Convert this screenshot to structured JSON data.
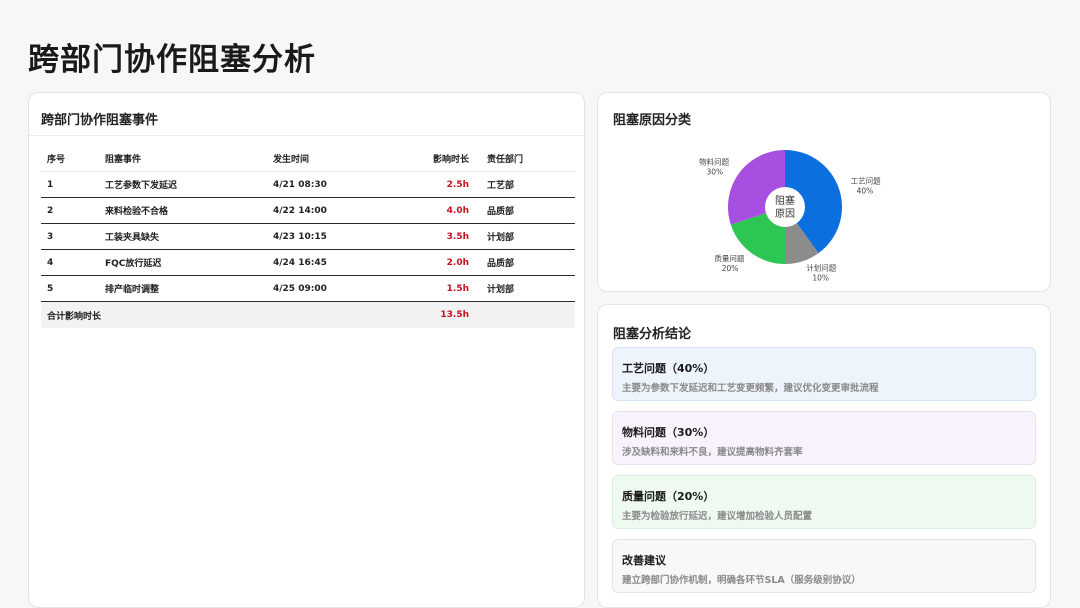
{
  "page": {
    "title": "跨部门协作阻塞分析"
  },
  "events_card": {
    "title": "跨部门协作阻塞事件",
    "columns": [
      "序号",
      "阻塞事件",
      "发生时间",
      "影响时长",
      "责任部门"
    ],
    "rows": [
      [
        "1",
        "工艺参数下发延迟",
        "4/21 08:30",
        "2.5h",
        "工艺部"
      ],
      [
        "2",
        "来料检验不合格",
        "4/22 14:00",
        "4.0h",
        "品质部"
      ],
      [
        "3",
        "工装夹具缺失",
        "4/23 10:15",
        "3.5h",
        "计划部"
      ],
      [
        "4",
        "FQC放行延迟",
        "4/24 16:45",
        "2.0h",
        "品质部"
      ],
      [
        "5",
        "排产临时调整",
        "4/25 09:00",
        "1.5h",
        "计划部"
      ]
    ],
    "total": {
      "label": "合计影响时长",
      "value": "13.5h"
    }
  },
  "pie_card": {
    "title": "阻塞原因分类",
    "center_label": [
      "阻塞",
      "原因"
    ]
  },
  "chart_data": {
    "type": "pie",
    "title": "阻塞原因分类",
    "slices": [
      {
        "label": "工艺问题",
        "value": 40,
        "display": "40%",
        "color": "#0b6fe0"
      },
      {
        "label": "计划问题",
        "value": 10,
        "display": "10%",
        "color": "#8c8c8c"
      },
      {
        "label": "质量问题",
        "value": 20,
        "display": "20%",
        "color": "#2dc653"
      },
      {
        "label": "物料问题",
        "value": 30,
        "display": "30%",
        "color": "#a64fe0"
      }
    ],
    "donut": true
  },
  "conclusion_card": {
    "title": "阻塞分析结论",
    "items": [
      {
        "title": "工艺问题（40%）",
        "desc": "主要为参数下发延迟和工艺变更频繁，建议优化变更审批流程"
      },
      {
        "title": "物料问题（30%）",
        "desc": "涉及缺料和来料不良，建议提高物料齐套率"
      },
      {
        "title": "质量问题（20%）",
        "desc": "主要为检验放行延迟，建议增加检验人员配置"
      },
      {
        "title": "改善建议",
        "desc": "建立跨部门协作机制，明确各环节SLA（服务级别协议）"
      }
    ]
  }
}
